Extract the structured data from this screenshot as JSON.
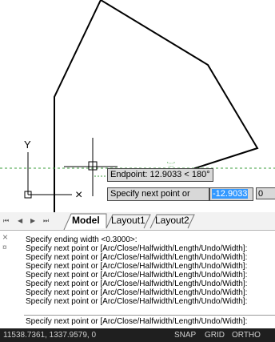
{
  "canvas": {
    "endpoint_tooltip": "Endpoint: 12.9033 < 180°",
    "prompt_tooltip": "Specify next point or",
    "input_distance_value": "-12.9033",
    "input_angle_value": "0",
    "ucs_y_label": "Y",
    "ucs_x_label": "×",
    "colors": {
      "background": "#ffffff",
      "line": "#000000",
      "grid_line": "#3b9d3b"
    }
  },
  "layout_tabs": {
    "nav_first": "⏮",
    "nav_prev": "◀",
    "nav_next": "▶",
    "nav_last": "⏭",
    "tabs": [
      {
        "label": "Model",
        "active": true
      },
      {
        "label": "Layout1",
        "active": false
      },
      {
        "label": "Layout2",
        "active": false
      }
    ]
  },
  "command_line": {
    "close_icon": "×",
    "pin_icon": "¤",
    "history": [
      "Specify ending width <0.3000>:",
      "Specify next point or [Arc/Close/Halfwidth/Length/Undo/Width]:",
      "Specify next point or [Arc/Close/Halfwidth/Length/Undo/Width]:",
      "Specify next point or [Arc/Close/Halfwidth/Length/Undo/Width]:",
      "Specify next point or [Arc/Close/Halfwidth/Length/Undo/Width]:",
      "Specify next point or [Arc/Close/Halfwidth/Length/Undo/Width]:",
      "Specify next point or [Arc/Close/Halfwidth/Length/Undo/Width]:",
      "Specify next point or [Arc/Close/Halfwidth/Length/Undo/Width]:"
    ],
    "current_prompt": "Specify next point or [Arc/Close/Halfwidth/Length/Undo/Width]:"
  },
  "status_bar": {
    "coordinates": "11538.7361, 1337.9579, 0",
    "snap": "SNAP",
    "grid": "GRID",
    "ortho": "ORTHO"
  }
}
